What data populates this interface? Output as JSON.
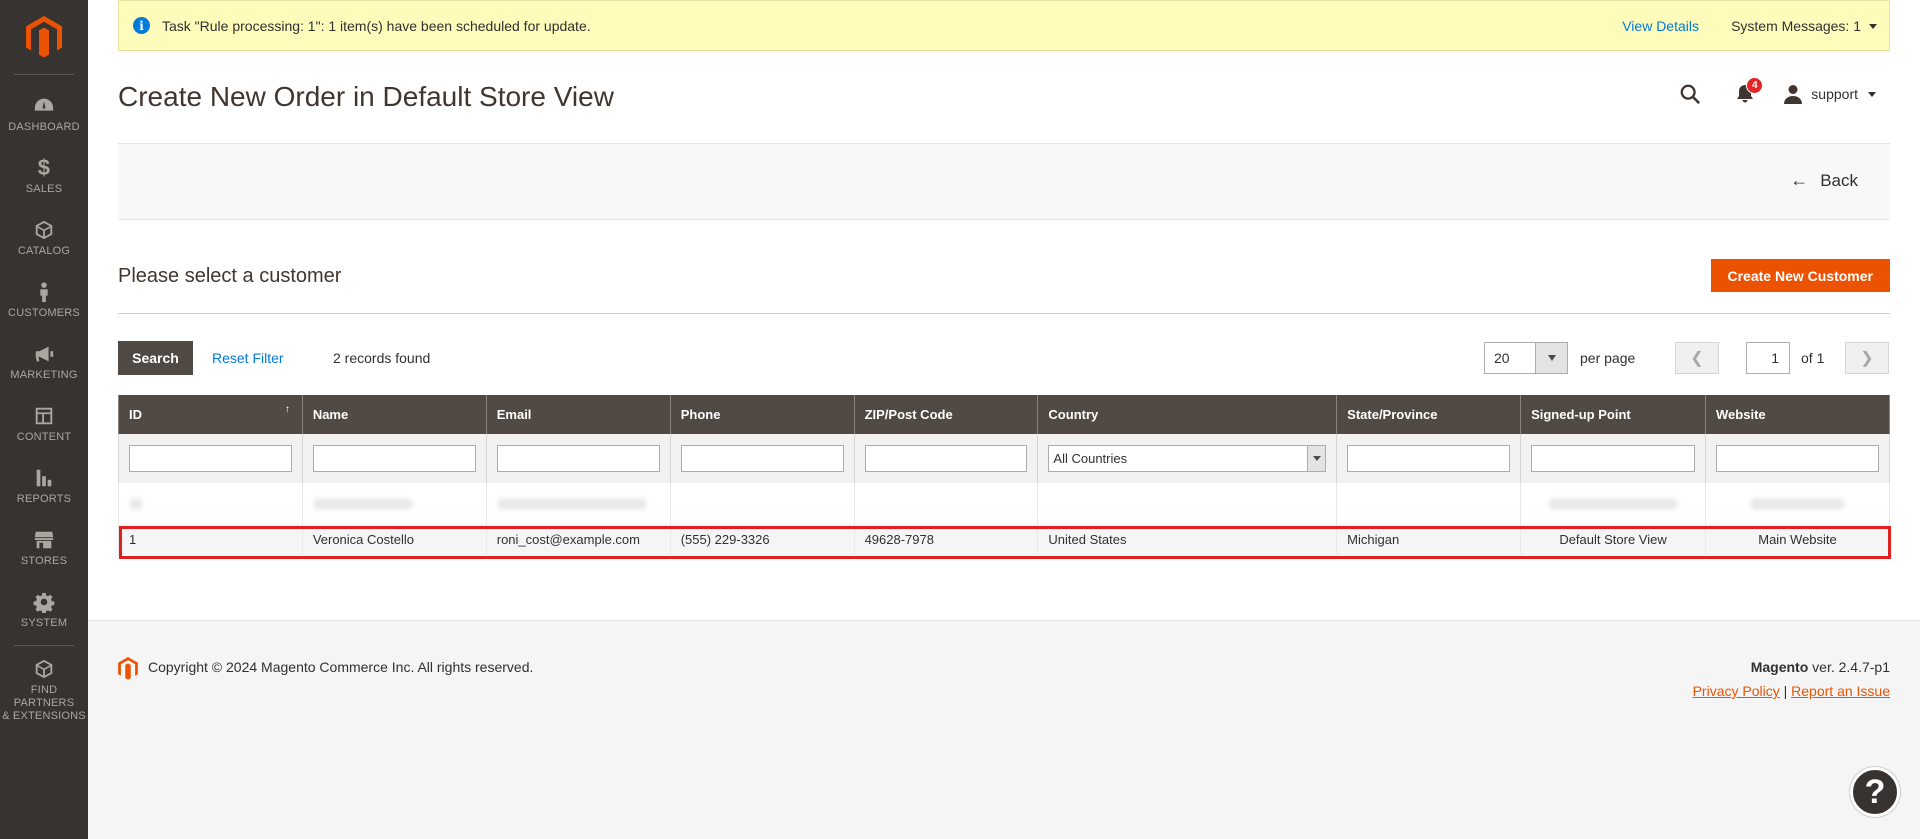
{
  "sidebar": {
    "items": [
      {
        "label": "Dashboard",
        "icon": "dashboard-icon"
      },
      {
        "label": "Sales",
        "icon": "dollar-icon"
      },
      {
        "label": "Catalog",
        "icon": "box-icon"
      },
      {
        "label": "Customers",
        "icon": "person-icon"
      },
      {
        "label": "Marketing",
        "icon": "megaphone-icon"
      },
      {
        "label": "Content",
        "icon": "layout-icon"
      },
      {
        "label": "Reports",
        "icon": "bar-chart-icon"
      },
      {
        "label": "Stores",
        "icon": "store-icon"
      },
      {
        "label": "System",
        "icon": "gear-icon"
      }
    ],
    "partners_line1": "Find Partners",
    "partners_line2": "& Extensions",
    "sales_glyph": "$"
  },
  "system_message": {
    "text": "Task \"Rule processing: 1\": 1 item(s) have been scheduled for update.",
    "view_details": "View Details",
    "messages_count": "System Messages: 1"
  },
  "header": {
    "title": "Create New Order in Default Store View",
    "notifications_count": "4",
    "user": "support"
  },
  "actions": {
    "back": "Back"
  },
  "customer_section": {
    "title": "Please select a customer",
    "create_button": "Create New Customer"
  },
  "grid_tools": {
    "search": "Search",
    "reset": "Reset Filter",
    "records": "2 records found",
    "per_page_value": "20",
    "per_page_label": "per page",
    "page_value": "1",
    "page_of": "of 1"
  },
  "table": {
    "columns": [
      "ID",
      "Name",
      "Email",
      "Phone",
      "ZIP/Post Code",
      "Country",
      "State/Province",
      "Signed-up Point",
      "Website"
    ],
    "country_filter": "All Countries",
    "rows": [
      {
        "id": "1",
        "name": "Veronica Costello",
        "email": "roni_cost@example.com",
        "phone": "(555) 229-3326",
        "zip": "49628-7978",
        "country": "United States",
        "state": "Michigan",
        "signup": "Default Store View",
        "website": "Main Website"
      }
    ]
  },
  "footer": {
    "copyright": "Copyright © 2024 Magento Commerce Inc. All rights reserved.",
    "brand": "Magento",
    "version": " ver. 2.4.7-p1",
    "privacy": "Privacy Policy",
    "separator": "|",
    "report": "Report an Issue"
  },
  "colors": {
    "sidebar_bg": "#373330",
    "accent": "#eb5202",
    "table_header": "#514943",
    "link": "#007bdb",
    "message_bg": "#fffbbb",
    "highlight": "#e02020"
  }
}
